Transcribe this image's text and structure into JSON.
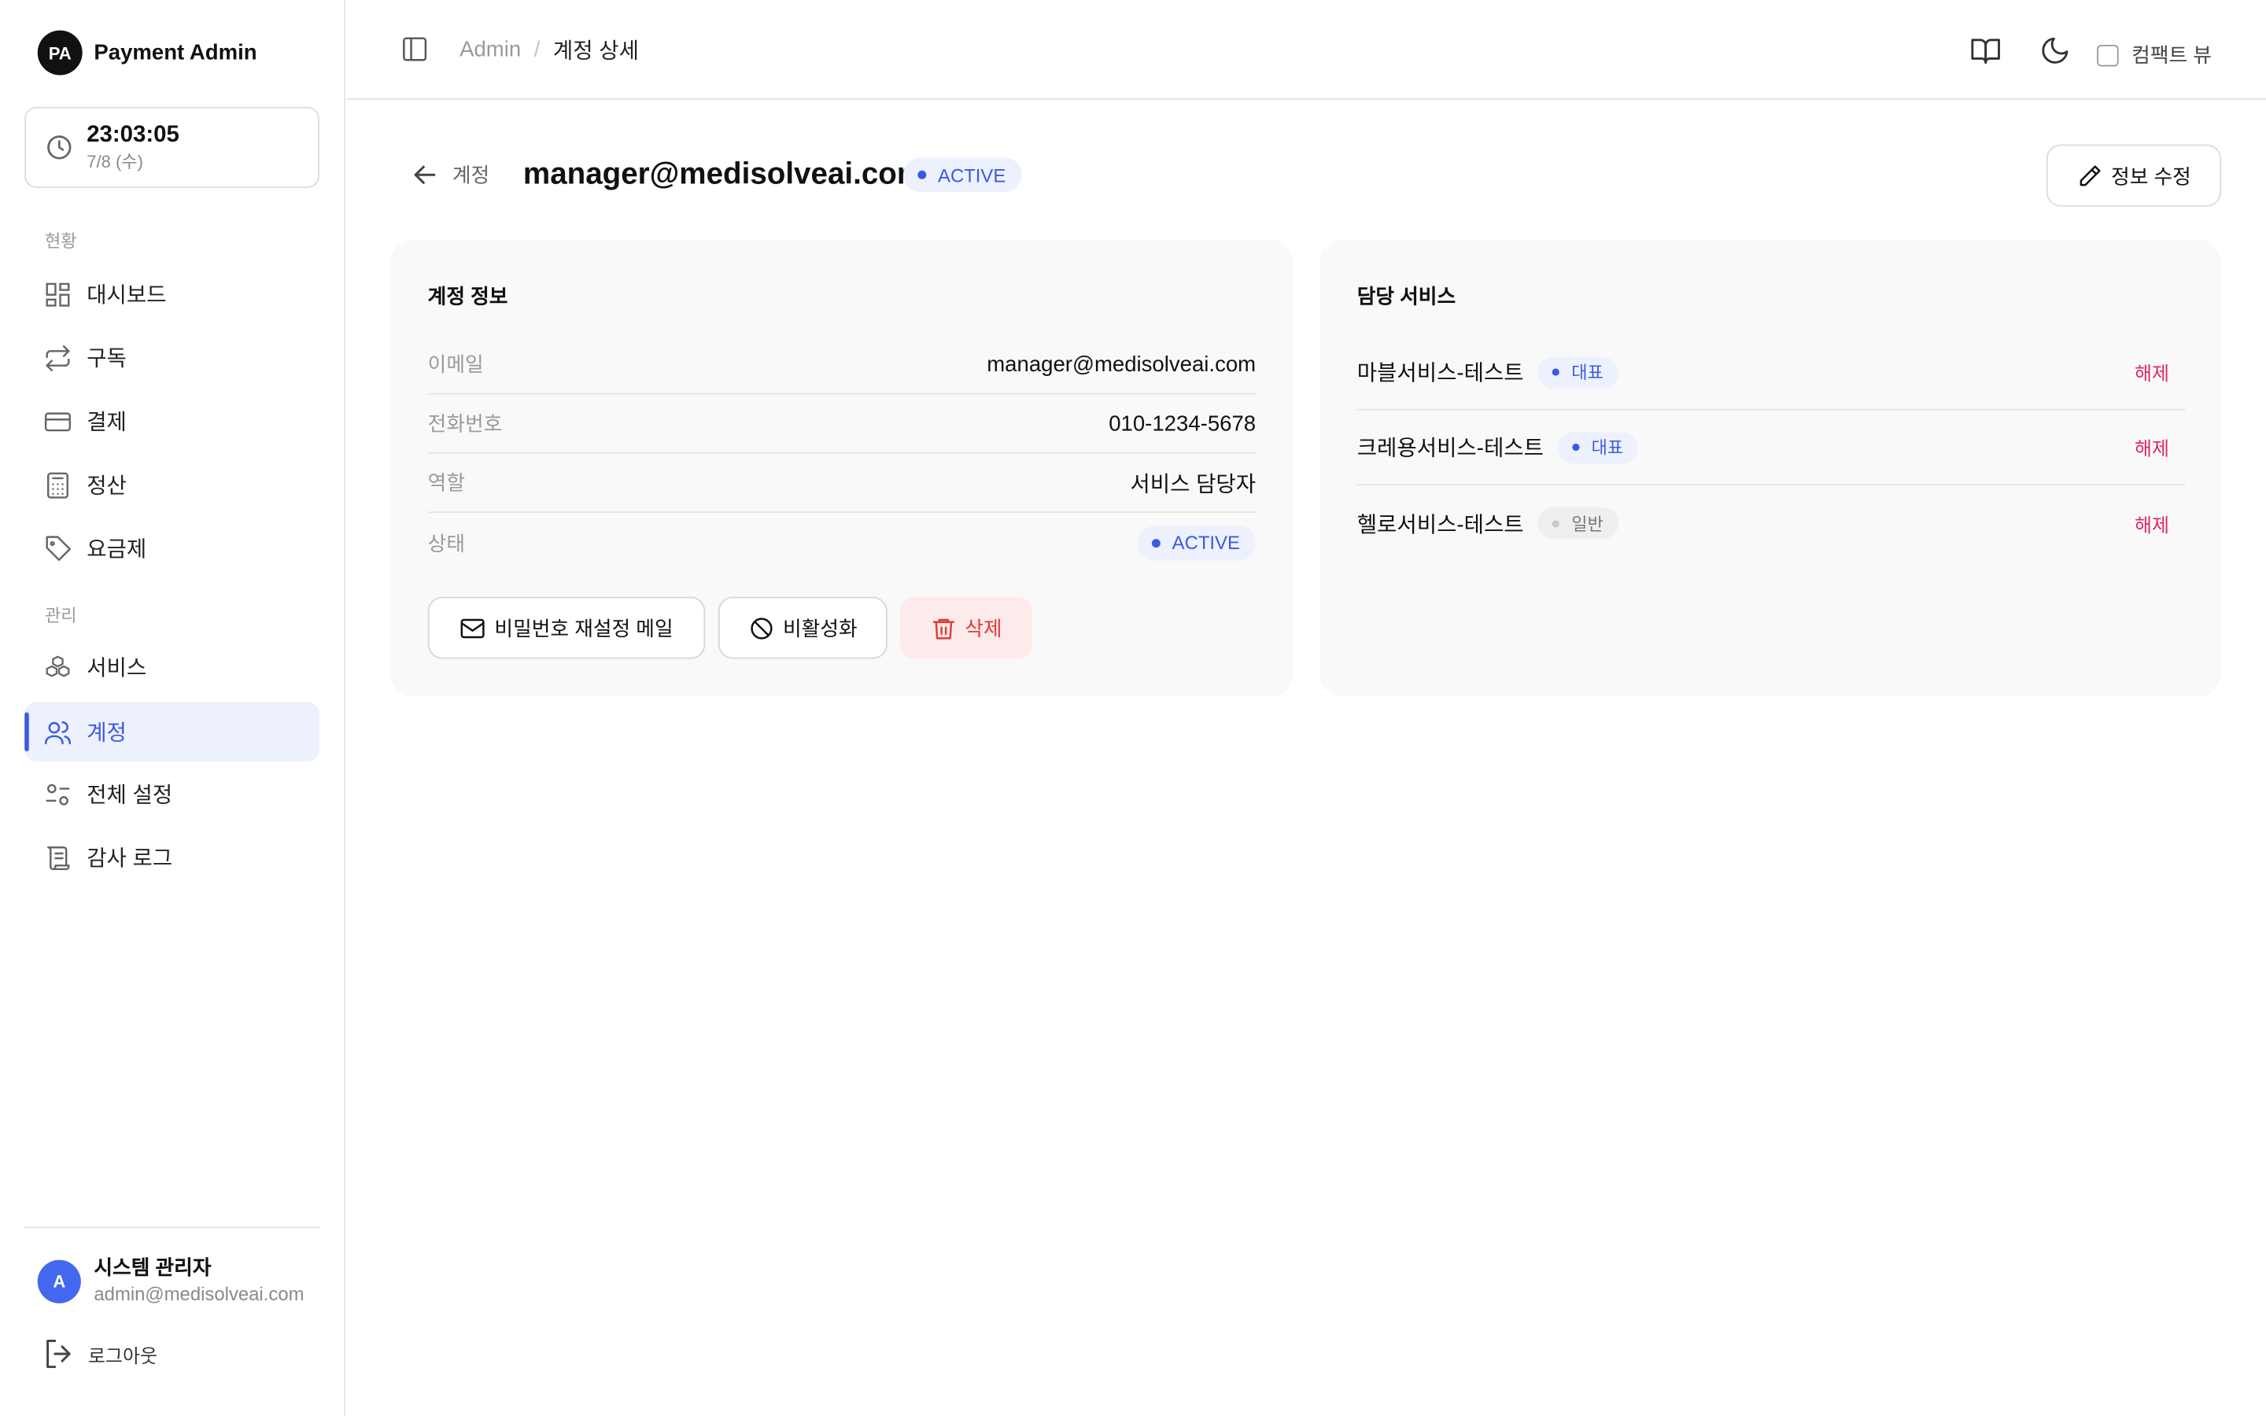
{
  "brand": {
    "logo_text": "PA",
    "name": "Payment Admin"
  },
  "clock": {
    "time": "23:03:05",
    "date": "7/8 (수)"
  },
  "sidebar": {
    "sections": [
      {
        "label": "현황"
      },
      {
        "label": "관리"
      }
    ],
    "items": [
      {
        "label": "대시보드",
        "icon": "dashboard-icon"
      },
      {
        "label": "구독",
        "icon": "repeat-icon"
      },
      {
        "label": "결제",
        "icon": "credit-card-icon"
      },
      {
        "label": "정산",
        "icon": "calculator-icon"
      },
      {
        "label": "요금제",
        "icon": "tag-icon"
      },
      {
        "label": "서비스",
        "icon": "boxes-icon"
      },
      {
        "label": "계정",
        "icon": "users-icon",
        "active": true
      },
      {
        "label": "전체 설정",
        "icon": "sliders-icon"
      },
      {
        "label": "감사 로그",
        "icon": "scroll-icon"
      }
    ],
    "user": {
      "avatar": "A",
      "name": "시스템 관리자",
      "email": "admin@medisolveai.com"
    },
    "logout_label": "로그아웃"
  },
  "topbar": {
    "breadcrumb": {
      "root": "Admin",
      "separator": "/",
      "current": "계정 상세"
    },
    "compact_label": "컴팩트 뷰",
    "compact_checked": false
  },
  "header": {
    "back_label": "계정",
    "title": "manager@medisolveai.com",
    "status": "ACTIVE",
    "edit_label": "정보 수정"
  },
  "account_info": {
    "title": "계정 정보",
    "rows": [
      {
        "label": "이메일",
        "value": "manager@medisolveai.com"
      },
      {
        "label": "전화번호",
        "value": "010-1234-5678"
      },
      {
        "label": "역할",
        "value": "서비스 담당자"
      },
      {
        "label": "상태",
        "value": "ACTIVE"
      }
    ],
    "actions": {
      "reset_password": "비밀번호 재설정 메일",
      "deactivate": "비활성화",
      "delete": "삭제"
    }
  },
  "services": {
    "title": "담당 서비스",
    "items": [
      {
        "name": "마블서비스-테스트",
        "tag": "대표",
        "action": "해제"
      },
      {
        "name": "크레용서비스-테스트",
        "tag": "대표",
        "action": "해제"
      },
      {
        "name": "헬로서비스-테스트",
        "tag": "일반",
        "action": "해제"
      }
    ]
  },
  "colors": {
    "accent": "#3a5be0",
    "accent_bg": "#edf1fe",
    "danger": "#e23b3b",
    "danger_bg": "#fdeaea",
    "unlink": "#e0245e"
  }
}
